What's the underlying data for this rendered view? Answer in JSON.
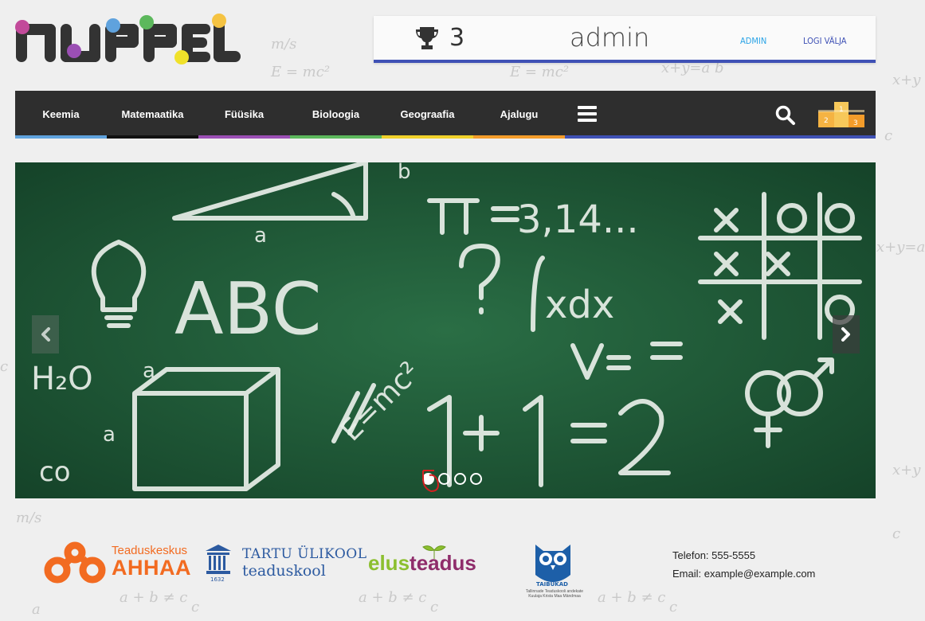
{
  "app": {
    "logo_text": "NUPPEL"
  },
  "user": {
    "score": "3",
    "name": "admin",
    "admin_link": "ADMIN",
    "logout_link": "LOGI VÄLJA"
  },
  "nav": {
    "items": [
      {
        "label": "Keemia",
        "color": "#5fa2dd"
      },
      {
        "label": "Matemaatika",
        "color": "#111111"
      },
      {
        "label": "Füüsika",
        "color": "#9b4fb4"
      },
      {
        "label": "Bioloogia",
        "color": "#5cb85c"
      },
      {
        "label": "Geograafia",
        "color": "#f0d12a"
      },
      {
        "label": "Ajalugu",
        "color": "#f39c2a"
      }
    ],
    "accent": "#3f51b5",
    "menu_icon": "hamburger-icon",
    "search_icon": "search-icon",
    "leaderboard_icon": "podium-icon",
    "podium_labels": [
      "2",
      "1",
      "3"
    ]
  },
  "carousel": {
    "slides": 4,
    "active_slide": 1,
    "board_color": "#1f5536"
  },
  "footer": {
    "partners": {
      "ahhaa_small": "Teaduskeskus",
      "ahhaa_big": "AHHAA",
      "tu_line1": "TARTU ÜLIKOOL",
      "tu_line2": "teaduskool",
      "tu_year": "1632",
      "elus_a": "elus",
      "elus_b": "teadus",
      "taibukad": "TAIBUKAD",
      "taibukad_sub": "Tallinnade Teaduskooli andekate Kuulaja Krista Maa Mändmaa"
    },
    "contact": {
      "phone": "Telefon: 555-5555",
      "email": "Email: example@example.com"
    }
  }
}
